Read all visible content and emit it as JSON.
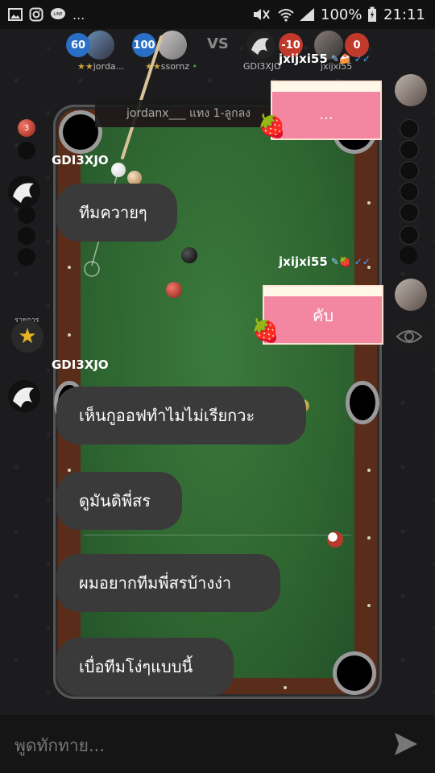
{
  "status_bar": {
    "battery": "100%",
    "time": "21:11",
    "dots": "..."
  },
  "match": {
    "vs_label": "VS",
    "team1": [
      {
        "score": "60",
        "name": "jorda..."
      },
      {
        "score": "100",
        "name": "ssornz"
      }
    ],
    "team2": [
      {
        "score": "-10",
        "name": "GDI3XJO"
      },
      {
        "score": "0",
        "name": "jxijxi55"
      }
    ]
  },
  "turn_banner": "jordanx___ แทง 1-ลูกลง",
  "left_rail": {
    "ball_number": "3"
  },
  "list_label": "รายการ",
  "chat": {
    "messages": [
      {
        "sender": "jxijxi55",
        "text": "...",
        "style": "cake"
      },
      {
        "sender": "GDI3XJO",
        "text": "ทีมควายๆ",
        "style": "dark"
      },
      {
        "sender": "jxijxi55",
        "text": "คับ",
        "style": "cake"
      },
      {
        "sender": "GDI3XJO",
        "text": "เห็นกูออฟทำไมไม่เรียกวะ",
        "style": "dark"
      },
      {
        "sender": "",
        "text": "ดูมันดิพี่สร",
        "style": "dark"
      },
      {
        "sender": "",
        "text": "ผมอยากทีมพี่สรบ้างง่า",
        "style": "dark"
      },
      {
        "sender": "",
        "text": "เบื่อทีมโง่ๆแบบนี้",
        "style": "dark"
      }
    ]
  },
  "input": {
    "placeholder": "พูดทักทาย..."
  },
  "colors": {
    "accent_blue": "#2a6fc6",
    "accent_red": "#c0392b",
    "cake_pink": "#f387a1",
    "felt": "#2e6530"
  }
}
